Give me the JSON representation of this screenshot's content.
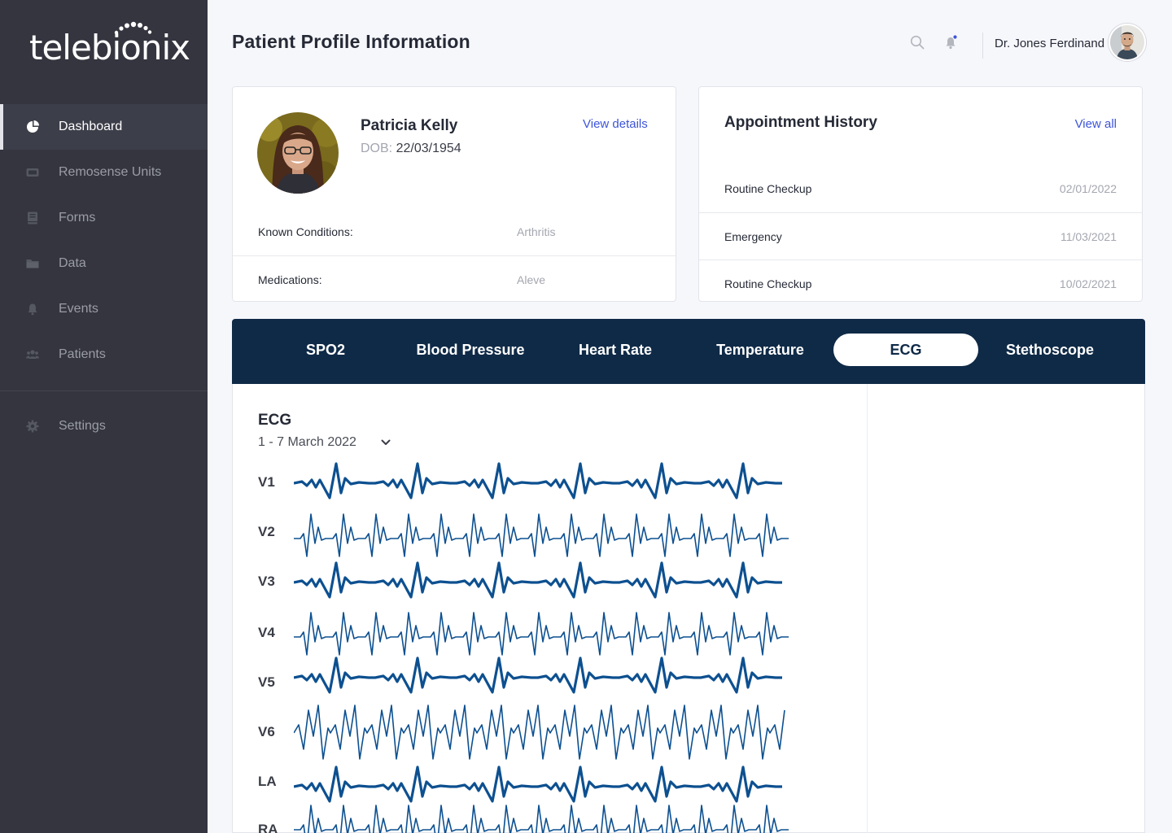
{
  "brand": {
    "name": "telebionix"
  },
  "sidebar": {
    "items": [
      {
        "label": "Dashboard",
        "icon": "pie-chart-icon",
        "active": true
      },
      {
        "label": "Remosense Units",
        "icon": "device-icon",
        "active": false
      },
      {
        "label": "Forms",
        "icon": "book-icon",
        "active": false
      },
      {
        "label": "Data",
        "icon": "folder-icon",
        "active": false
      },
      {
        "label": "Events",
        "icon": "bell-icon",
        "active": false
      },
      {
        "label": "Patients",
        "icon": "users-icon",
        "active": false
      }
    ],
    "settings_label": "Settings"
  },
  "header": {
    "title": "Patient Profile Information",
    "user_name": "Dr. Jones Ferdinand"
  },
  "patient": {
    "name": "Patricia Kelly",
    "dob_label": "DOB:",
    "dob": "22/03/1954",
    "view_details_label": "View details",
    "known_conditions_label": "Known Conditions:",
    "known_conditions": "Arthritis",
    "medications_label": "Medications:",
    "medications": "Aleve"
  },
  "appointments": {
    "title": "Appointment History",
    "view_all_label": "View all",
    "items": [
      {
        "type": "Routine Checkup",
        "date": "02/01/2022"
      },
      {
        "type": "Emergency",
        "date": "11/03/2021"
      },
      {
        "type": "Routine Checkup",
        "date": "10/02/2021"
      }
    ]
  },
  "tabs": [
    {
      "label": "SPO2",
      "active": false
    },
    {
      "label": "Blood Pressure",
      "active": false
    },
    {
      "label": "Heart Rate",
      "active": false
    },
    {
      "label": "Temperature",
      "active": false
    },
    {
      "label": "ECG",
      "active": true
    },
    {
      "label": "Stethoscope",
      "active": false
    }
  ],
  "ecg": {
    "title": "ECG",
    "date_range": "1 - 7 March 2022",
    "leads": [
      "V1",
      "V2",
      "V3",
      "V4",
      "V5",
      "V6",
      "LA",
      "RA"
    ],
    "color": "#0d5090"
  },
  "colors": {
    "accent": "#3d54d8",
    "navy": "#0f2a47",
    "sidebar": "#34353f",
    "notification_dot": "#3d54d8"
  }
}
